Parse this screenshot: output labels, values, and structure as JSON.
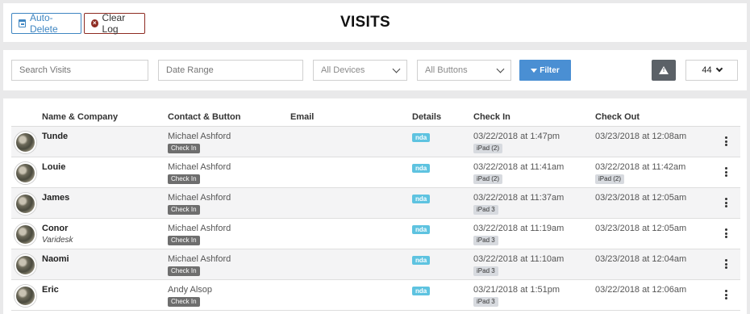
{
  "header": {
    "auto_delete_label": "Auto-Delete",
    "clear_log_label": "Clear Log",
    "title": "VISITS"
  },
  "filters": {
    "search_placeholder": "Search Visits",
    "date_range_placeholder": "Date Range",
    "devices_selected": "All Devices",
    "buttons_selected": "All Buttons",
    "filter_label": "Filter",
    "per_page_value": "44"
  },
  "table": {
    "columns": {
      "name_company": "Name & Company",
      "contact_button": "Contact & Button",
      "email": "Email",
      "details": "Details",
      "check_in": "Check In",
      "check_out": "Check Out"
    },
    "rows": [
      {
        "name": "Tunde",
        "company": "",
        "contact": "Michael Ashford",
        "button": "Check In",
        "details": "nda",
        "check_in": "03/22/2018 at 1:47pm",
        "check_in_device": "iPad (2)",
        "check_out": "03/23/2018 at 12:08am",
        "check_out_device": ""
      },
      {
        "name": "Louie",
        "company": "",
        "contact": "Michael Ashford",
        "button": "Check In",
        "details": "nda",
        "check_in": "03/22/2018 at 11:41am",
        "check_in_device": "iPad (2)",
        "check_out": "03/22/2018 at 11:42am",
        "check_out_device": "iPad (2)"
      },
      {
        "name": "James",
        "company": "",
        "contact": "Michael Ashford",
        "button": "Check In",
        "details": "nda",
        "check_in": "03/22/2018 at 11:37am",
        "check_in_device": "iPad 3",
        "check_out": "03/23/2018 at 12:05am",
        "check_out_device": ""
      },
      {
        "name": "Conor",
        "company": "Varidesk",
        "contact": "Michael Ashford",
        "button": "Check In",
        "details": "nda",
        "check_in": "03/22/2018 at 11:19am",
        "check_in_device": "iPad 3",
        "check_out": "03/23/2018 at 12:05am",
        "check_out_device": ""
      },
      {
        "name": "Naomi",
        "company": "",
        "contact": "Michael Ashford",
        "button": "Check In",
        "details": "nda",
        "check_in": "03/22/2018 at 11:10am",
        "check_in_device": "iPad 3",
        "check_out": "03/23/2018 at 12:04am",
        "check_out_device": ""
      },
      {
        "name": "Eric",
        "company": "",
        "contact": "Andy Alsop",
        "button": "Check In",
        "details": "nda",
        "check_in": "03/21/2018 at 1:51pm",
        "check_in_device": "iPad 3",
        "check_out": "03/22/2018 at 12:06am",
        "check_out_device": ""
      }
    ]
  }
}
